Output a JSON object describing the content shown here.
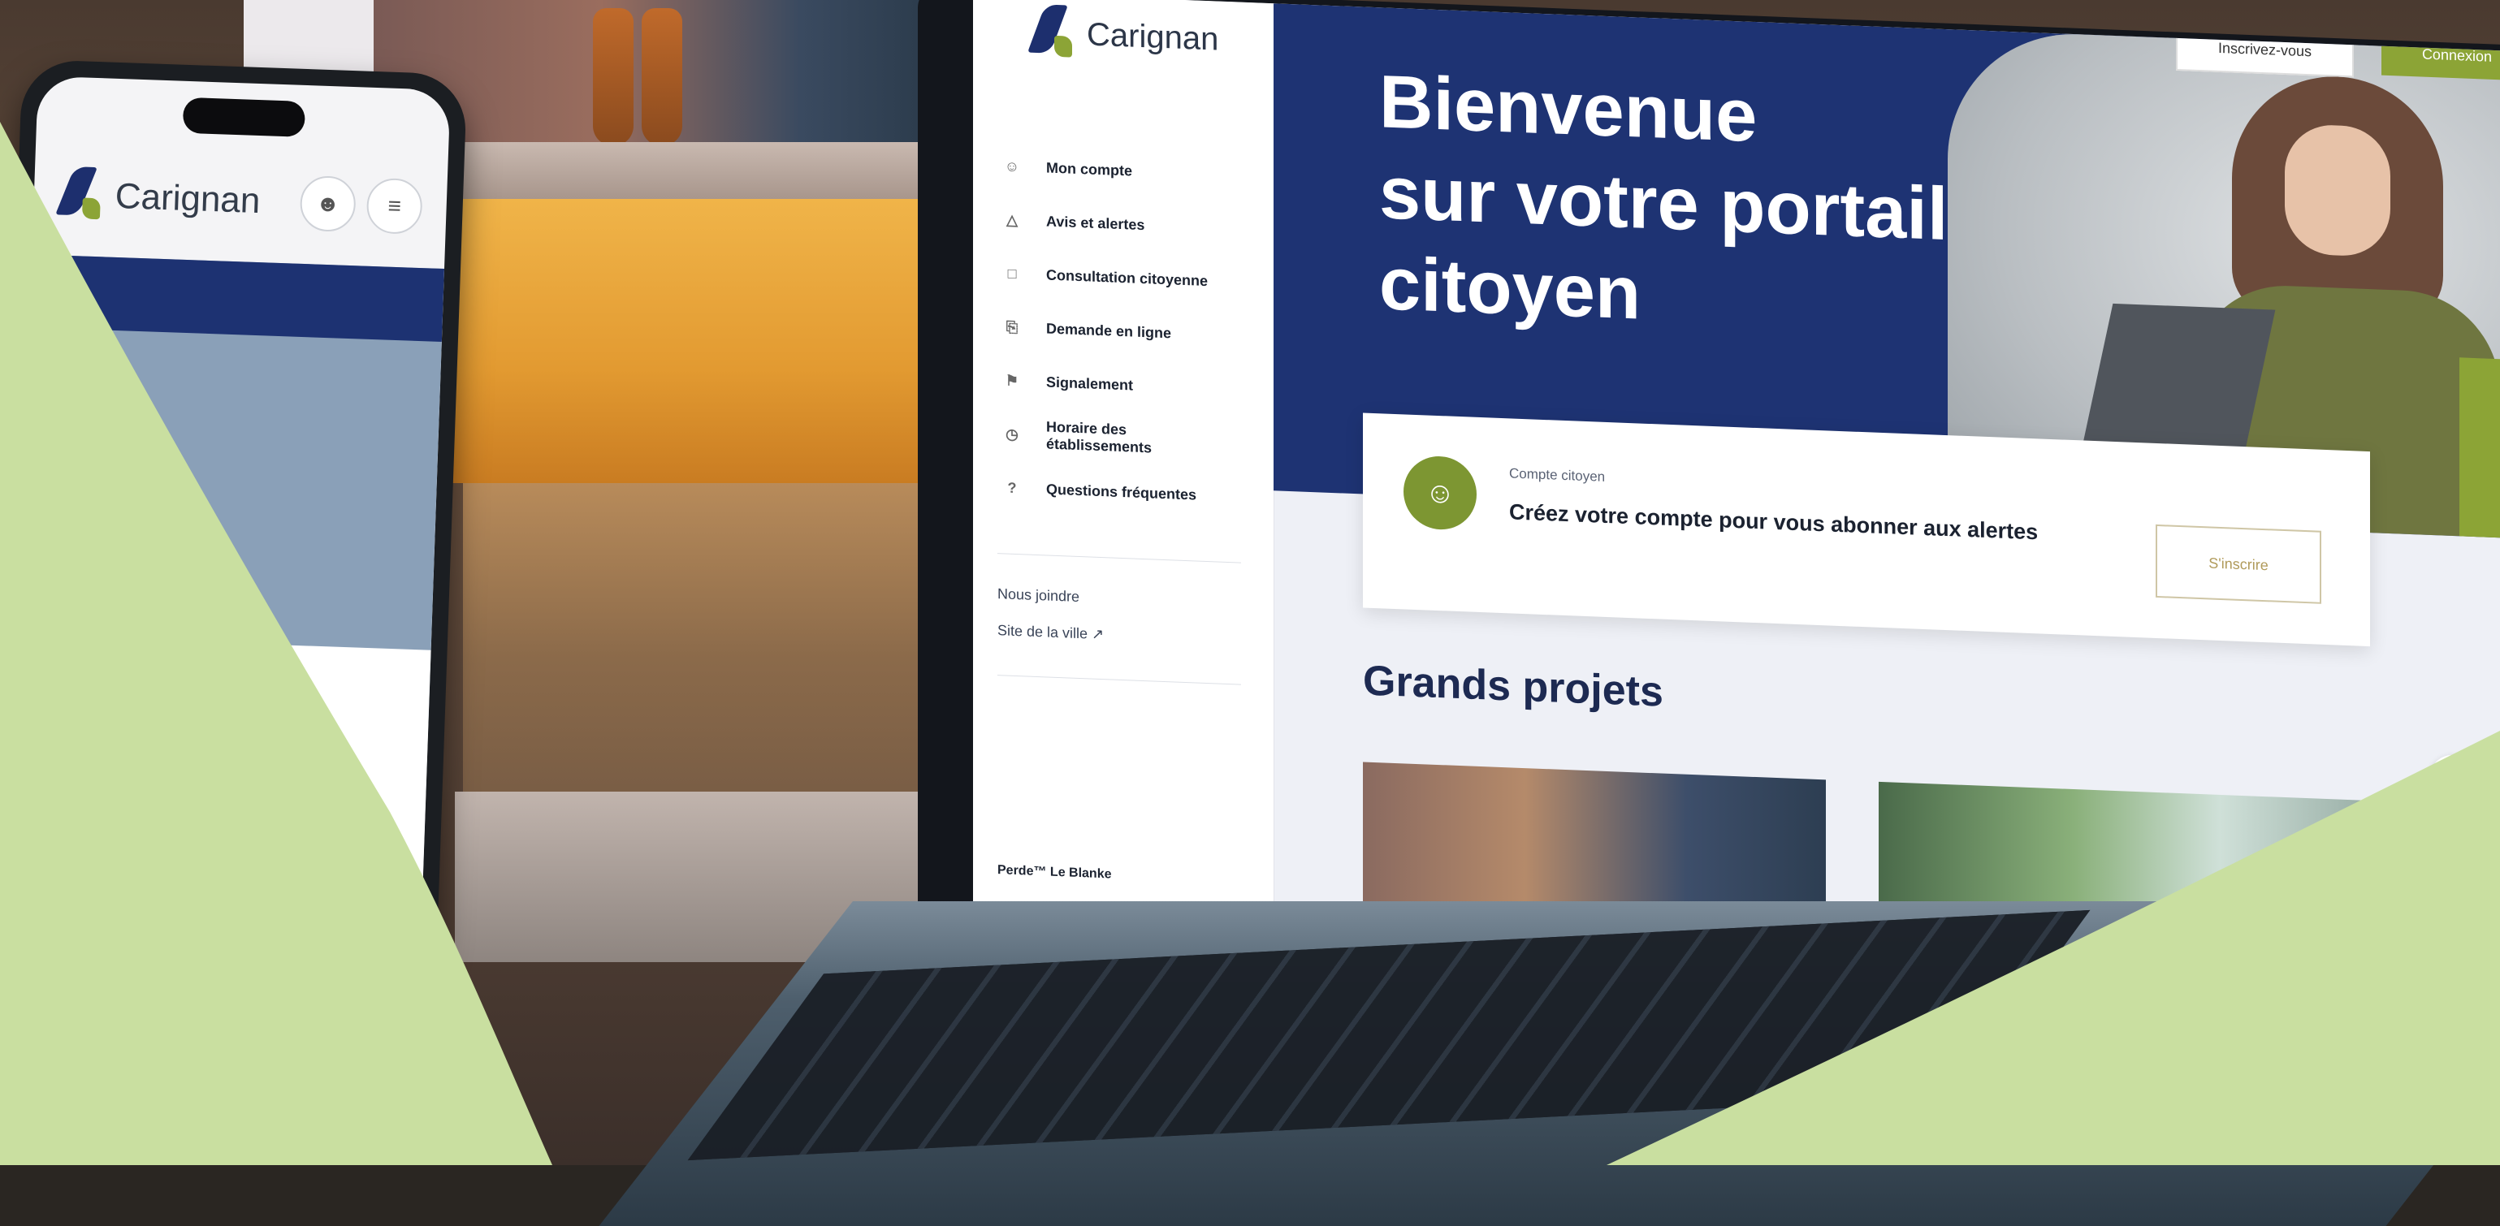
{
  "colors": {
    "accent_green": "#8ca436",
    "navy": "#1e3373",
    "pastel_green": "#c9dfa0"
  },
  "brand": {
    "name": "Carignan"
  },
  "phone": {
    "brand": "Carignan",
    "account_icon": "user-icon",
    "menu_icon": "menu-icon"
  },
  "laptop": {
    "sidebar": {
      "nav": [
        {
          "label": "Mon compte",
          "icon": "user-icon"
        },
        {
          "label": "Avis et alertes",
          "icon": "alert-icon"
        },
        {
          "label": "Consultation citoyenne",
          "icon": "chat-icon"
        },
        {
          "label": "Demande en ligne",
          "icon": "document-icon"
        },
        {
          "label": "Signalement",
          "icon": "flag-icon"
        },
        {
          "label": "Horaire des établissements",
          "icon": "clock-icon"
        },
        {
          "label": "Questions fréquentes",
          "icon": "question-icon"
        }
      ],
      "links": {
        "contact": "Nous joindre",
        "city_site": "Site de la ville ↗"
      },
      "footer": "Perde™ Le Blanke"
    },
    "header": {
      "register_button": "Inscrivez-vous",
      "login_button": "Connexion"
    },
    "hero": {
      "title": "Bienvenue\nsur votre portail\ncitoyen"
    },
    "cta": {
      "eyebrow": "Compte citoyen",
      "title": "Créez votre compte pour vous abonner aux alertes",
      "button": "S'inscrire"
    },
    "projects": {
      "title": "Grands projets",
      "prev_icon": "chevron-left-icon",
      "next_icon": "chevron-right-icon"
    }
  }
}
